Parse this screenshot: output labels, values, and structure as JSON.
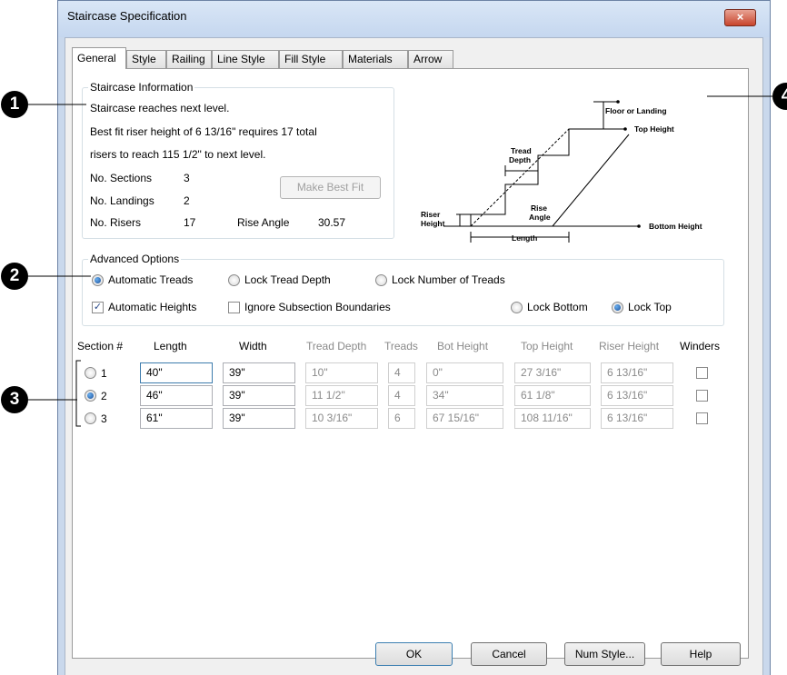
{
  "window": {
    "title": "Staircase Specification",
    "close_label": "×"
  },
  "tabs": [
    "General",
    "Style",
    "Railing",
    "Line Style",
    "Fill Style",
    "Materials",
    "Arrow"
  ],
  "staircase_info": {
    "group_label": "Staircase Information",
    "line1": "Staircase reaches next level.",
    "line2": "Best fit riser height of 6 13/16\" requires 17 total",
    "line3": "risers to reach 115 1/2\" to next level.",
    "sections_label": "No. Sections",
    "sections_value": "3",
    "landings_label": "No. Landings",
    "landings_value": "2",
    "risers_label": "No. Risers",
    "risers_value": "17",
    "rise_angle_label": "Rise Angle",
    "rise_angle_value": "30.57",
    "best_fit_button": "Make Best Fit"
  },
  "diagram": {
    "floor_label": "Floor or Landing",
    "top_height": "Top Height",
    "tread_depth_line1": "Tread",
    "tread_depth_line2": "Depth",
    "riser_line1": "Riser",
    "riser_line2": "Height",
    "rise_line1": "Rise",
    "rise_line2": "Angle",
    "bottom_height": "Bottom Height",
    "length": "Length"
  },
  "advanced": {
    "group_label": "Advanced Options",
    "automatic_treads": "Automatic Treads",
    "lock_tread_depth": "Lock Tread Depth",
    "lock_number_treads": "Lock Number of Treads",
    "automatic_heights": "Automatic Heights",
    "ignore_subsection": "Ignore Subsection Boundaries",
    "lock_bottom": "Lock Bottom",
    "lock_top": "Lock Top",
    "automatic_treads_selected": true,
    "automatic_heights_checked": true,
    "ignore_subsection_checked": false,
    "lock_top_selected": true
  },
  "table": {
    "headers": [
      "Section #",
      "Length",
      "Width",
      "Tread Depth",
      "Treads",
      "Bot Height",
      "Top Height",
      "Riser Height",
      "Winders"
    ],
    "rows": [
      {
        "num": "1",
        "length": "40\"",
        "width": "39\"",
        "tread_depth": "10\"",
        "treads": "4",
        "bot_height": "0\"",
        "top_height": "27 3/16\"",
        "riser_height": "6 13/16\"",
        "selected": false
      },
      {
        "num": "2",
        "length": "46\"",
        "width": "39\"",
        "tread_depth": "11 1/2\"",
        "treads": "4",
        "bot_height": "34\"",
        "top_height": "61 1/8\"",
        "riser_height": "6 13/16\"",
        "selected": true
      },
      {
        "num": "3",
        "length": "61\"",
        "width": "39\"",
        "tread_depth": "10 3/16\"",
        "treads": "6",
        "bot_height": "67 15/16\"",
        "top_height": "108 11/16\"",
        "riser_height": "6 13/16\"",
        "selected": false
      }
    ]
  },
  "footer": {
    "ok": "OK",
    "cancel": "Cancel",
    "num_style": "Num Style...",
    "help": "Help"
  },
  "callouts": [
    "1",
    "2",
    "3",
    "4"
  ]
}
